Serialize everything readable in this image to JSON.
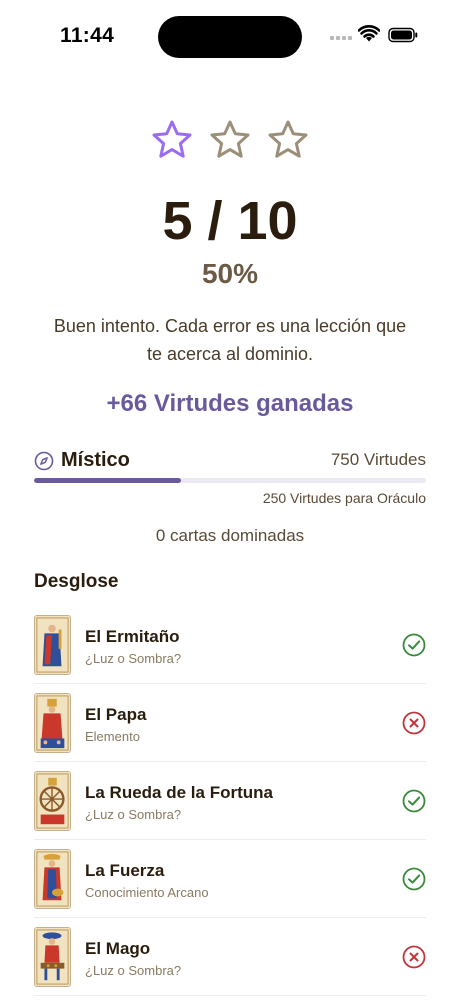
{
  "status_bar": {
    "time": "11:44"
  },
  "result": {
    "stars_total": 3,
    "stars_earned": 1,
    "score_text": "5 / 10",
    "percent_text": "50%",
    "message": "Buen intento. Cada error es una lección que te acerca al dominio.",
    "virtues_earned": "+66 Virtudes ganadas"
  },
  "level": {
    "name": "Místico",
    "virtues": "750 Virtudes",
    "progress": 0.375,
    "next_level_text": "250 Virtudes para Oráculo",
    "mastered_text": "0 cartas dominadas"
  },
  "breakdown": {
    "title": "Desglose",
    "items": [
      {
        "name": "El Ermitaño",
        "category": "¿Luz o Sombra?",
        "correct": true
      },
      {
        "name": "El Papa",
        "category": "Elemento",
        "correct": false
      },
      {
        "name": "La Rueda de la Fortuna",
        "category": "¿Luz o Sombra?",
        "correct": true
      },
      {
        "name": "La Fuerza",
        "category": "Conocimiento Arcano",
        "correct": true
      },
      {
        "name": "El Mago",
        "category": "¿Luz o Sombra?",
        "correct": false
      }
    ]
  },
  "colors": {
    "accent_purple": "#6a5a9c",
    "star_active": "#9b6cf0",
    "star_inactive": "#9c8f7a",
    "correct_green": "#3a8a3c",
    "wrong_red": "#c0353a",
    "text_dark": "#2a1d0e",
    "text_brown": "#6b5a45"
  },
  "icons": {
    "star": "star-icon",
    "level": "compass-icon",
    "correct": "check-circle-icon",
    "wrong": "x-circle-icon"
  }
}
